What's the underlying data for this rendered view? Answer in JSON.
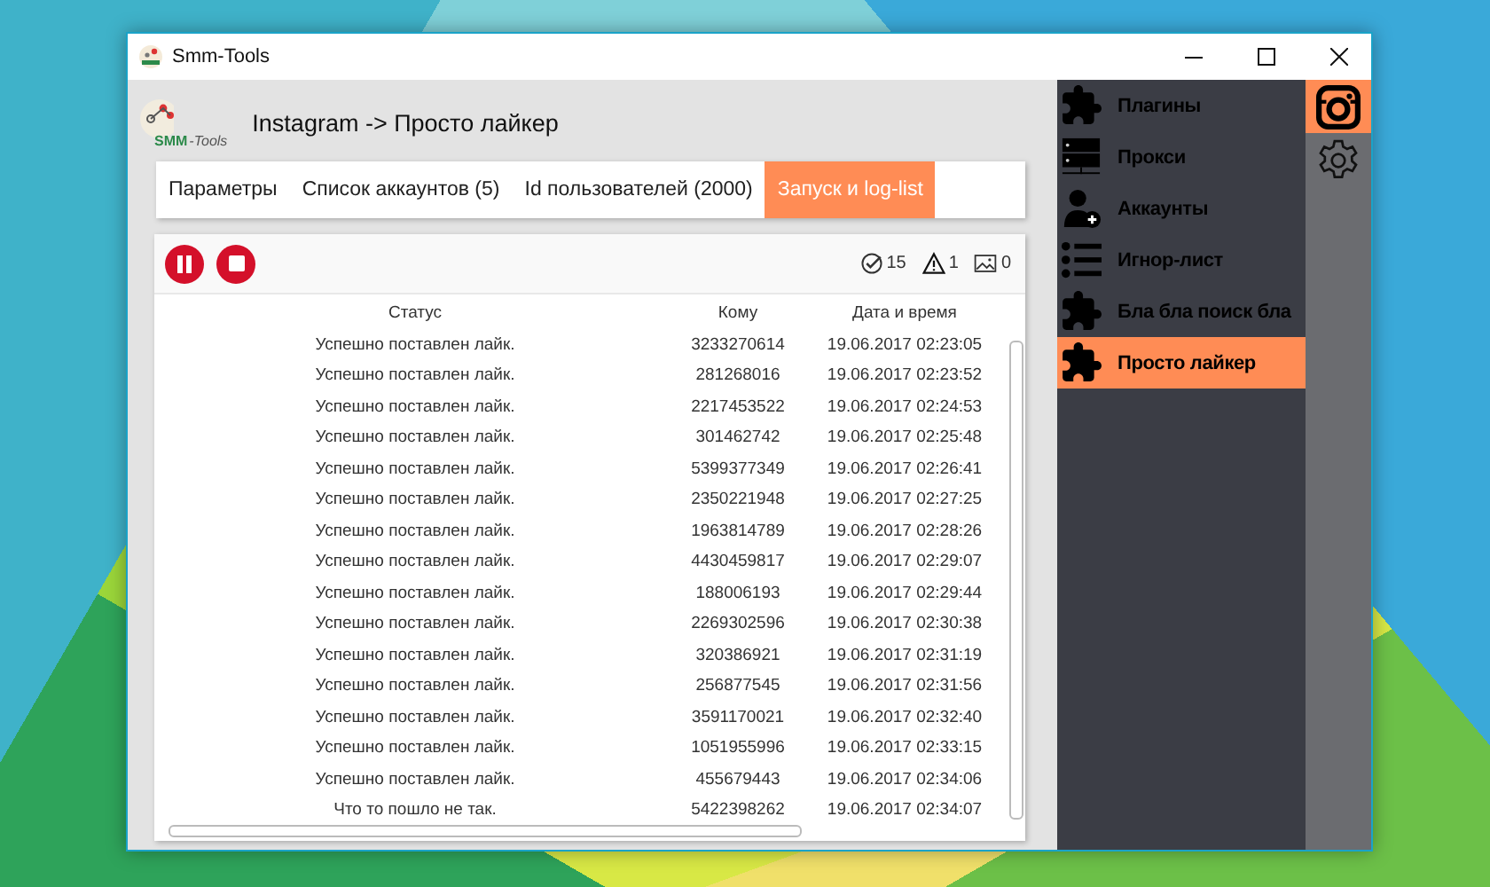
{
  "window": {
    "title": "Smm-Tools"
  },
  "header": {
    "logo_text": "SMM",
    "logo_suffix": "-Tools",
    "title": "Instagram -> Просто лайкер"
  },
  "tabs": [
    {
      "label": "Параметры",
      "selected": false
    },
    {
      "label": "Список аккаунтов (5)",
      "selected": false
    },
    {
      "label": "Id пользователей (2000)",
      "selected": false
    },
    {
      "label": "Запуск и log-list",
      "selected": true
    }
  ],
  "toolbar": {
    "buttons": [
      {
        "kind": "pause"
      },
      {
        "kind": "stop"
      }
    ],
    "counters": [
      {
        "kind": "success",
        "value": "15"
      },
      {
        "kind": "warning",
        "value": "1"
      },
      {
        "kind": "image",
        "value": "0"
      }
    ]
  },
  "table": {
    "columns": [
      "Статус",
      "Кому",
      "Дата и время"
    ],
    "rows": [
      [
        "Успешно поставлен лайк.",
        "3233270614",
        "19.06.2017 02:23:05"
      ],
      [
        "Успешно поставлен лайк.",
        "281268016",
        "19.06.2017 02:23:52"
      ],
      [
        "Успешно поставлен лайк.",
        "2217453522",
        "19.06.2017 02:24:53"
      ],
      [
        "Успешно поставлен лайк.",
        "301462742",
        "19.06.2017 02:25:48"
      ],
      [
        "Успешно поставлен лайк.",
        "5399377349",
        "19.06.2017 02:26:41"
      ],
      [
        "Успешно поставлен лайк.",
        "2350221948",
        "19.06.2017 02:27:25"
      ],
      [
        "Успешно поставлен лайк.",
        "1963814789",
        "19.06.2017 02:28:26"
      ],
      [
        "Успешно поставлен лайк.",
        "4430459817",
        "19.06.2017 02:29:07"
      ],
      [
        "Успешно поставлен лайк.",
        "188006193",
        "19.06.2017 02:29:44"
      ],
      [
        "Успешно поставлен лайк.",
        "2269302596",
        "19.06.2017 02:30:38"
      ],
      [
        "Успешно поставлен лайк.",
        "320386921",
        "19.06.2017 02:31:19"
      ],
      [
        "Успешно поставлен лайк.",
        "256877545",
        "19.06.2017 02:31:56"
      ],
      [
        "Успешно поставлен лайк.",
        "3591170021",
        "19.06.2017 02:32:40"
      ],
      [
        "Успешно поставлен лайк.",
        "1051955996",
        "19.06.2017 02:33:15"
      ],
      [
        "Успешно поставлен лайк.",
        "455679443",
        "19.06.2017 02:34:06"
      ],
      [
        "Что то пошло не так.",
        "5422398262",
        "19.06.2017 02:34:07"
      ]
    ]
  },
  "sidebar": {
    "items": [
      {
        "kind": "plugin",
        "label": "Плагины",
        "selected": false
      },
      {
        "kind": "server",
        "label": "Прокси",
        "selected": false
      },
      {
        "kind": "user",
        "label": "Аккаунты",
        "selected": false
      },
      {
        "kind": "list",
        "label": "Игнор-лист",
        "selected": false
      },
      {
        "kind": "plugin",
        "label": "Бла бла поиск бла",
        "selected": false
      },
      {
        "kind": "plugin",
        "label": "Просто лайкер",
        "selected": true
      }
    ]
  },
  "rail": {
    "items": [
      {
        "kind": "instagram",
        "selected": true
      },
      {
        "kind": "settings",
        "selected": false
      }
    ]
  }
}
